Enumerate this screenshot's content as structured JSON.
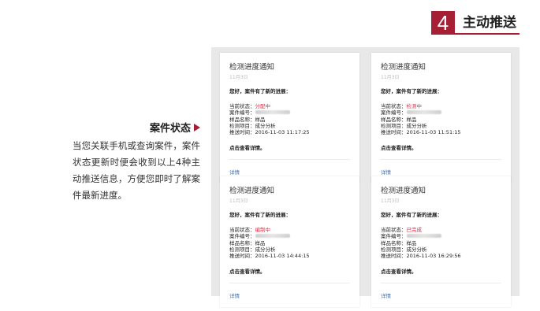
{
  "header": {
    "step_number": "4",
    "title": "主动推送"
  },
  "description": {
    "title": "案件状态",
    "body": "当您关联手机或查询案件，案件状态更新时便会收到以上4种主动推送信息，方便您即时了解案件最新进度。"
  },
  "cards": [
    {
      "title": "检测进度通知",
      "date": "11月3日",
      "greeting": "您好，案件有了新的进展：",
      "status_label": "当前状态：",
      "status": "分配中",
      "case_label": "案件编号：",
      "sample_label": "样品名称：",
      "sample": "样品",
      "item_label": "检测项目：",
      "item": "成分分析",
      "time_label": "推送时间：",
      "time": "2016-11-03 11:17:25",
      "tip": "点击查看详情。",
      "link": "详情"
    },
    {
      "title": "检测进度通知",
      "date": "11月3日",
      "greeting": "您好，案件有了新的进展：",
      "status_label": "当前状态：",
      "status": "检测中",
      "case_label": "案件编号：",
      "sample_label": "样品名称：",
      "sample": "样品",
      "item_label": "检测项目：",
      "item": "成分分析",
      "time_label": "推送时间：",
      "time": "2016-11-03 11:51:15",
      "tip": "点击查看详情。",
      "link": "详情"
    },
    {
      "title": "检测进度通知",
      "date": "11月3日",
      "greeting": "您好，案件有了新的进展：",
      "status_label": "当前状态：",
      "status": "编制中",
      "case_label": "案件编号：",
      "sample_label": "样品名称：",
      "sample": "样品",
      "item_label": "检测项目：",
      "item": "成分分析",
      "time_label": "推送时间：",
      "time": "2016-11-03 14:44:15",
      "tip": "点击查看详情。",
      "link": "详情"
    },
    {
      "title": "检测进度通知",
      "date": "11月3日",
      "greeting": "您好，案件有了新的进展：",
      "status_label": "当前状态：",
      "status": "已完成",
      "case_label": "案件编号：",
      "sample_label": "样品名称：",
      "sample": "样品",
      "item_label": "检测项目：",
      "item": "成分分析",
      "time_label": "推送时间：",
      "time": "2016-11-03 16:29:56",
      "tip": "点击查看详情。",
      "link": "详情"
    }
  ],
  "colors": {
    "accent": "#a51f35",
    "status": "#d6304a",
    "link": "#4a6fa5",
    "panel": "#e8e8e8"
  }
}
